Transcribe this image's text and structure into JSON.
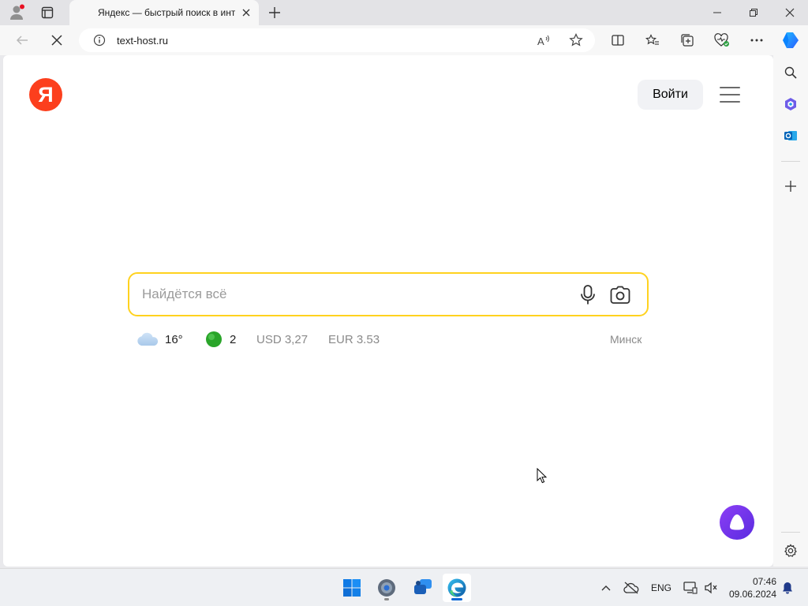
{
  "browser": {
    "tab_title": "Яндекс — быстрый поиск в инт",
    "url": "text-host.ru"
  },
  "page": {
    "logo_letter": "Я",
    "login_label": "Войти",
    "search": {
      "placeholder": "Найдётся всё",
      "value": ""
    },
    "informers": {
      "weather_temp": "16°",
      "traffic_score": "2",
      "usd": "USD 3,27",
      "eur": "EUR 3.53",
      "city": "Минск"
    }
  },
  "taskbar": {
    "language": "ENG",
    "time": "07:46",
    "date": "09.06.2024"
  },
  "colors": {
    "yandex_red": "#fc3f1d",
    "search_border": "#ffd21f",
    "alice_purple": "#7a35f0",
    "traffic_green": "#2aa52a"
  },
  "icons": [
    "profile-icon",
    "tab-actions-icon",
    "new-tab-icon",
    "back-icon",
    "stop-loading-icon",
    "site-info-icon",
    "read-aloud-icon",
    "favorite-star-icon",
    "split-screen-icon",
    "favorites-icon",
    "collections-icon",
    "browser-essentials-icon",
    "more-icon",
    "copilot-icon",
    "search-icon",
    "microsoft365-icon",
    "outlook-icon",
    "add-icon",
    "settings-icon",
    "microphone-icon",
    "camera-search-icon",
    "weather-cloud-icon",
    "traffic-light-icon",
    "alice-icon",
    "windows-start-icon",
    "settings-gear-icon",
    "chat-icon",
    "edge-icon",
    "chevron-up-icon",
    "network-icon",
    "display-icon",
    "sound-icon",
    "notification-bell-icon"
  ]
}
